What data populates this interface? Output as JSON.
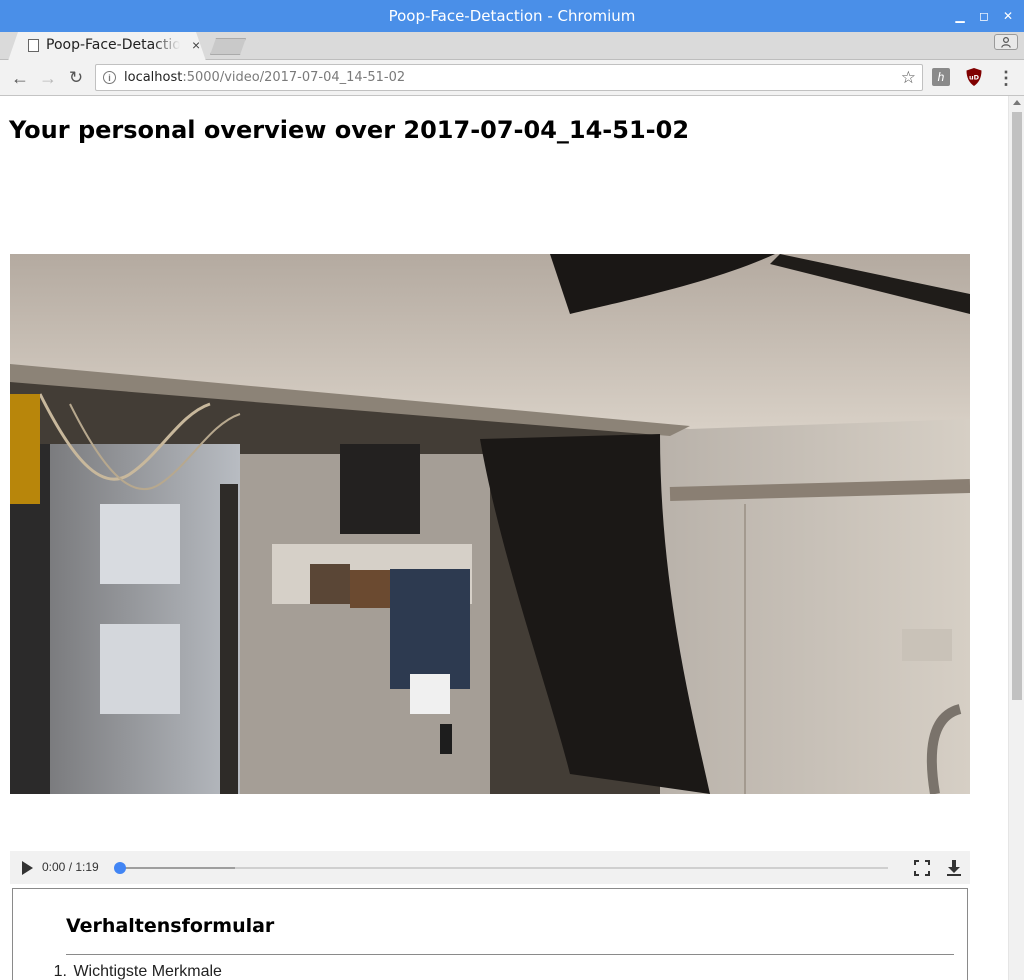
{
  "window": {
    "title": "Poop-Face-Detaction - Chromium",
    "controls": {
      "minimize": "▁",
      "maximize": "◻",
      "close": "✕"
    }
  },
  "tab": {
    "title": "Poop-Face-Detaction",
    "close_glyph": "×",
    "favicon_icon": "page-icon"
  },
  "toolbar": {
    "back_glyph": "←",
    "forward_glyph": "→",
    "reload_glyph": "↻",
    "url_host": "localhost",
    "url_rest": ":5000/video/2017-07-04_14-51-02",
    "bookmark_glyph": "☆",
    "info_glyph": "i",
    "menu_glyph": "⋮",
    "extension_1_glyph": "h",
    "extension_2_label": "uD"
  },
  "page": {
    "title": "Your personal overview over 2017-07-04_14-51-02"
  },
  "video": {
    "time_display": "0:00 / 1:19",
    "progress_fraction": 0,
    "buffered_fraction": 0.15
  },
  "form": {
    "heading": "Verhaltensformular",
    "items": [
      {
        "number": "1.",
        "label": "Wichtigste Merkmale"
      }
    ]
  },
  "colors": {
    "titlebar": "#4a8fe8",
    "seek_thumb": "#4285f4"
  }
}
